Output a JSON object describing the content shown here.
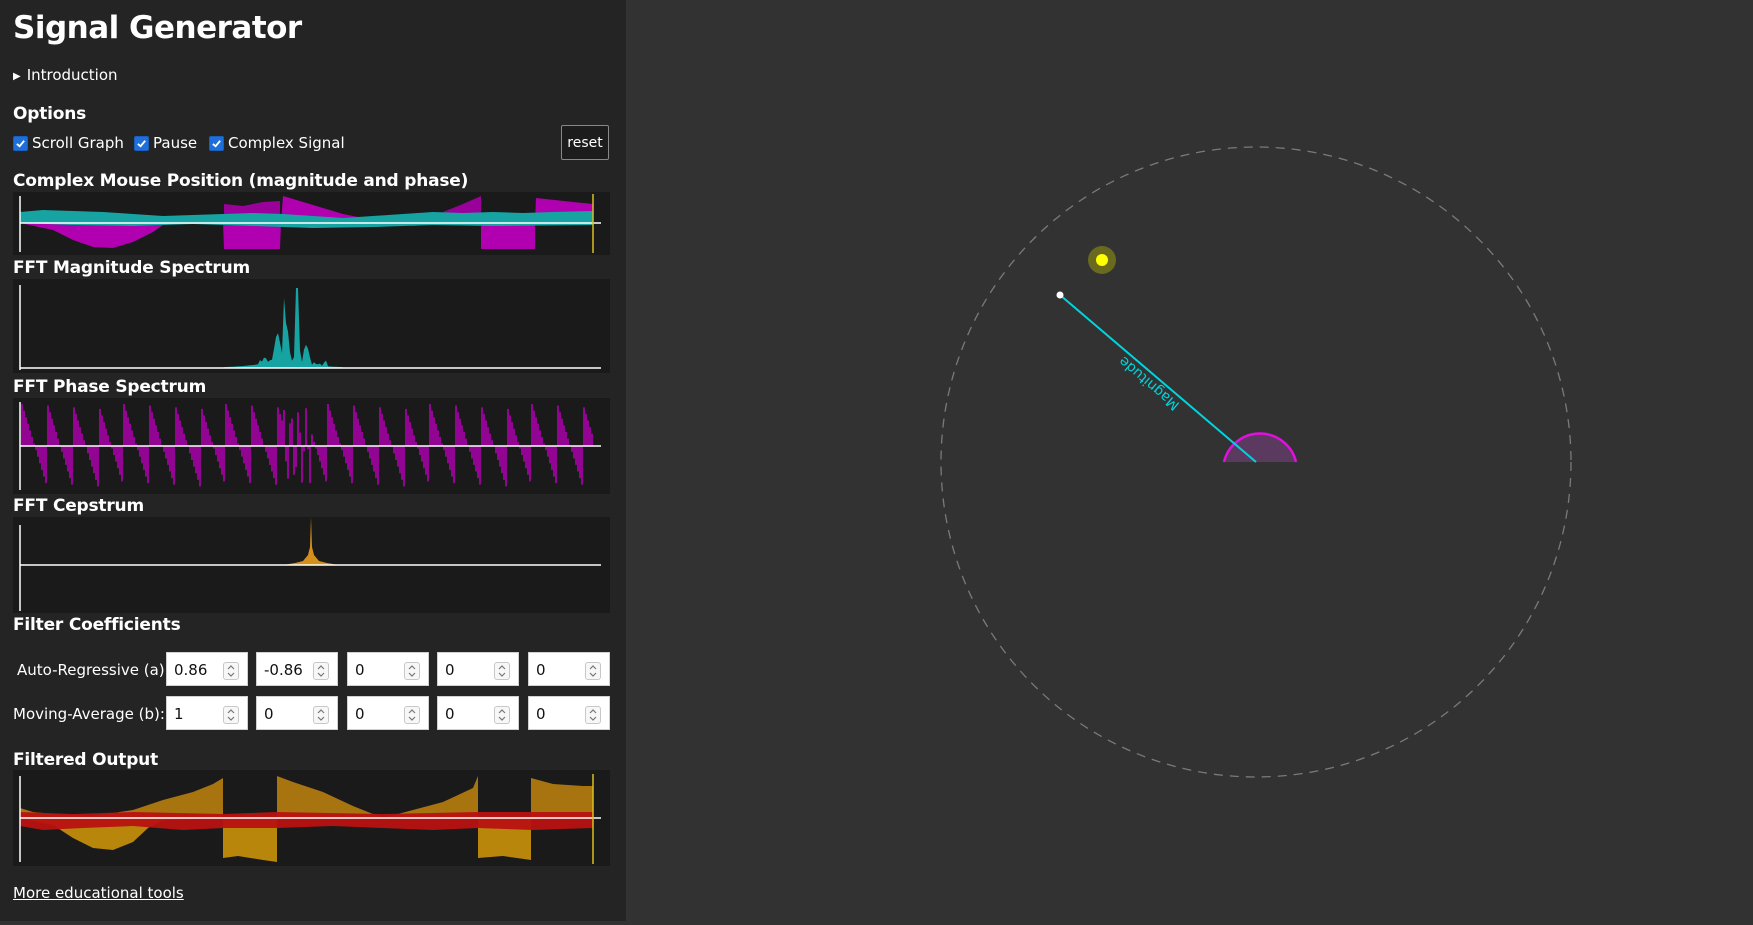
{
  "app": {
    "title": "Signal Generator",
    "intro_label": "Introduction"
  },
  "options": {
    "heading": "Options",
    "scroll_graph": {
      "label": "Scroll Graph",
      "checked": true
    },
    "pause": {
      "label": "Pause",
      "checked": true
    },
    "complex_signal": {
      "label": "Complex Signal",
      "checked": true
    },
    "reset_label": "reset"
  },
  "plots": {
    "complex_mouse": {
      "title": "Complex Mouse Position (magnitude and phase)"
    },
    "fft_magnitude": {
      "title": "FFT Magnitude Spectrum"
    },
    "fft_phase": {
      "title": "FFT Phase Spectrum"
    },
    "fft_cepstrum": {
      "title": "FFT Cepstrum"
    },
    "filtered_output": {
      "title": "Filtered Output"
    }
  },
  "filter": {
    "heading": "Filter Coefficients",
    "ar_label": "Auto-Regressive (a):",
    "ma_label": "Moving-Average (b):",
    "a": [
      "0.86",
      "-0.86",
      "0",
      "0",
      "0"
    ],
    "b": [
      "1",
      "0",
      "0",
      "0",
      "0"
    ]
  },
  "footer": {
    "link_label": "More educational tools"
  },
  "canvas": {
    "magnitude_label": "Magnitude"
  },
  "colors": {
    "magnitude": "#18a3a3",
    "phase": "#b000b0",
    "cepstrum": "#d4901a",
    "output_primary": "#b8860b",
    "output_secondary": "#c01010",
    "accent_line": "#00d4dc",
    "cursor": "#ffff00"
  }
}
